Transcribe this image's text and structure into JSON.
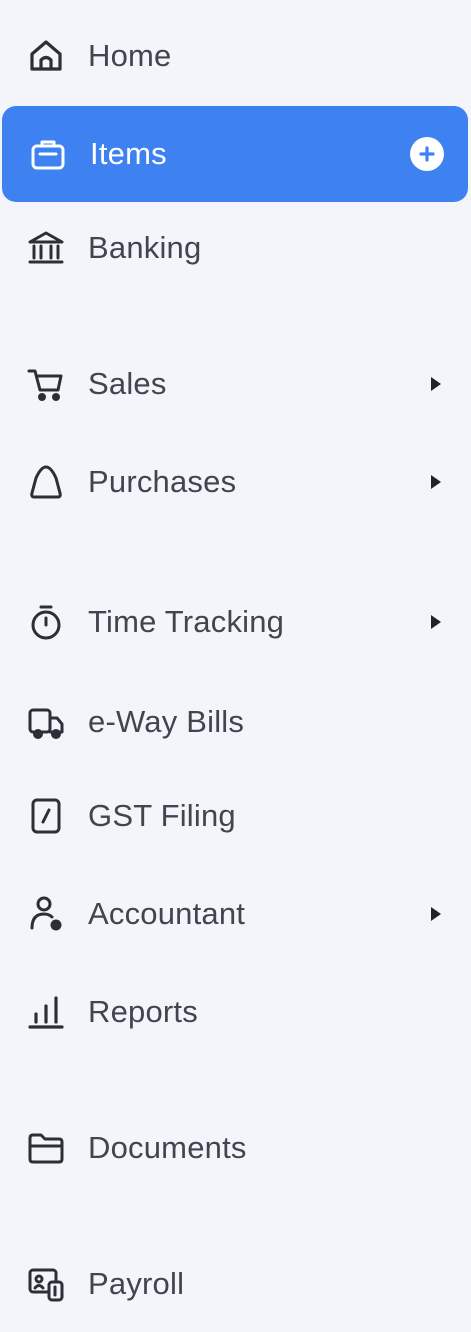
{
  "colors": {
    "background": "#f4f5fa",
    "active_bg": "#3d82f0",
    "text": "#40454f",
    "active_text": "#ffffff"
  },
  "nav": {
    "items": [
      {
        "label": "Home",
        "icon": "home-icon",
        "active": false,
        "has_submenu": false
      },
      {
        "label": "Items",
        "icon": "items-icon",
        "active": true,
        "has_submenu": false,
        "action_icon": "add-circle-icon"
      },
      {
        "label": "Banking",
        "icon": "bank-icon",
        "active": false,
        "has_submenu": false
      },
      {
        "label": "Sales",
        "icon": "cart-icon",
        "active": false,
        "has_submenu": true
      },
      {
        "label": "Purchases",
        "icon": "bag-icon",
        "active": false,
        "has_submenu": true
      },
      {
        "label": "Time Tracking",
        "icon": "stopwatch-icon",
        "active": false,
        "has_submenu": true
      },
      {
        "label": "e-Way Bills",
        "icon": "truck-icon",
        "active": false,
        "has_submenu": false
      },
      {
        "label": "GST Filing",
        "icon": "document-icon",
        "active": false,
        "has_submenu": false
      },
      {
        "label": "Accountant",
        "icon": "accountant-icon",
        "active": false,
        "has_submenu": true
      },
      {
        "label": "Reports",
        "icon": "bar-chart-icon",
        "active": false,
        "has_submenu": false
      },
      {
        "label": "Documents",
        "icon": "folder-icon",
        "active": false,
        "has_submenu": false
      },
      {
        "label": "Payroll",
        "icon": "payroll-icon",
        "active": false,
        "has_submenu": false
      }
    ]
  }
}
